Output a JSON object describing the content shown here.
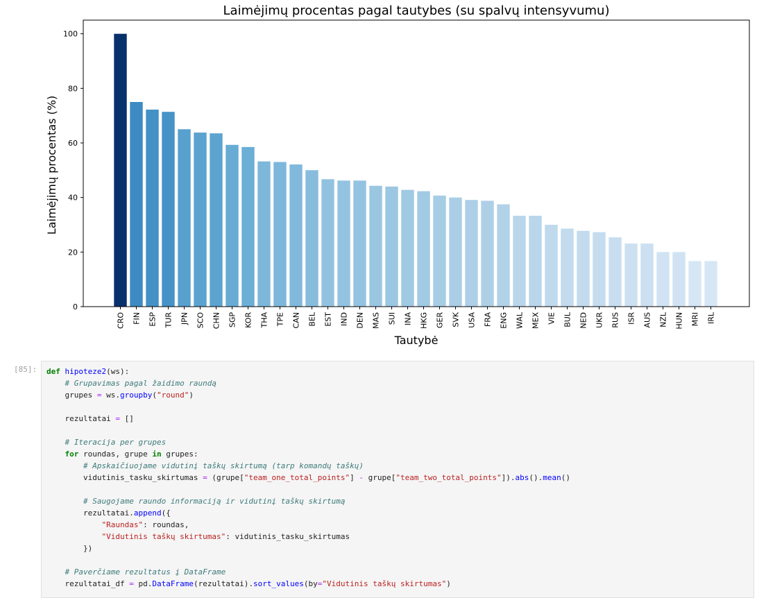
{
  "chart_data": {
    "type": "bar",
    "title": "Laimėjimų procentas pagal tautybes (su spalvų intensyvumu)",
    "xlabel": "Tautybė",
    "ylabel": "Laimėjimų procentas (%)",
    "ylim": [
      0,
      105
    ],
    "yticks": [
      "0",
      "20",
      "40",
      "60",
      "80",
      "100"
    ],
    "grid": false,
    "legend": "none",
    "colormap": "Blues (darker = higher value)",
    "categories": [
      "CRO",
      "FIN",
      "ESP",
      "TUR",
      "JPN",
      "SCO",
      "CHN",
      "SGP",
      "KOR",
      "THA",
      "TPE",
      "CAN",
      "BEL",
      "EST",
      "IND",
      "DEN",
      "MAS",
      "SUI",
      "INA",
      "HKG",
      "GER",
      "SVK",
      "USA",
      "FRA",
      "ENG",
      "WAL",
      "MEX",
      "VIE",
      "BUL",
      "NED",
      "UKR",
      "RUS",
      "ISR",
      "AUS",
      "NZL",
      "HUN",
      "MRI",
      "IRL"
    ],
    "values": [
      100,
      75,
      72.2,
      71.4,
      65,
      63.8,
      63.5,
      59.3,
      58.5,
      53.2,
      53,
      52.1,
      50,
      46.7,
      46.2,
      46.2,
      44.3,
      44,
      42.8,
      42.3,
      40.7,
      40,
      39.1,
      38.8,
      37.5,
      33.3,
      33.3,
      30,
      28.6,
      27.8,
      27.3,
      25.4,
      23.1,
      23.1,
      20,
      20,
      16.7,
      16.7
    ]
  },
  "cell": {
    "prompt": "[85]:",
    "code_lines": [
      [
        [
          "kw",
          "def"
        ],
        [
          "tx",
          " "
        ],
        [
          "fn",
          "hipoteze2"
        ],
        [
          "tx",
          "(ws):"
        ]
      ],
      [
        [
          "tx",
          "    "
        ],
        [
          "cm",
          "# Grupavimas pagal žaidimo raundą"
        ]
      ],
      [
        [
          "tx",
          "    grupes "
        ],
        [
          "op",
          "="
        ],
        [
          "tx",
          " ws."
        ],
        [
          "fn",
          "groupby"
        ],
        [
          "tx",
          "("
        ],
        [
          "st",
          "\"round\""
        ],
        [
          "tx",
          ")"
        ]
      ],
      [],
      [
        [
          "tx",
          "    rezultatai "
        ],
        [
          "op",
          "="
        ],
        [
          "tx",
          " []"
        ]
      ],
      [],
      [
        [
          "tx",
          "    "
        ],
        [
          "cm",
          "# Iteracija per grupes"
        ]
      ],
      [
        [
          "tx",
          "    "
        ],
        [
          "kw",
          "for"
        ],
        [
          "tx",
          " roundas, grupe "
        ],
        [
          "kw",
          "in"
        ],
        [
          "tx",
          " grupes:"
        ]
      ],
      [
        [
          "tx",
          "        "
        ],
        [
          "cm",
          "# Apskaičiuojame vidutinį taškų skirtumą (tarp komandų taškų)"
        ]
      ],
      [
        [
          "tx",
          "        vidutinis_tasku_skirtumas "
        ],
        [
          "op",
          "="
        ],
        [
          "tx",
          " (grupe["
        ],
        [
          "st",
          "\"team_one_total_points\""
        ],
        [
          "tx",
          "] "
        ],
        [
          "op",
          "-"
        ],
        [
          "tx",
          " grupe["
        ],
        [
          "st",
          "\"team_two_total_points\""
        ],
        [
          "tx",
          "])."
        ],
        [
          "fn",
          "abs"
        ],
        [
          "tx",
          "()."
        ],
        [
          "fn",
          "mean"
        ],
        [
          "tx",
          "()"
        ]
      ],
      [],
      [
        [
          "tx",
          "        "
        ],
        [
          "cm",
          "# Saugojame raundo informaciją ir vidutinį taškų skirtumą"
        ]
      ],
      [
        [
          "tx",
          "        rezultatai."
        ],
        [
          "fn",
          "append"
        ],
        [
          "tx",
          "({"
        ]
      ],
      [
        [
          "tx",
          "            "
        ],
        [
          "st",
          "\"Raundas\""
        ],
        [
          "tx",
          ": roundas,"
        ]
      ],
      [
        [
          "tx",
          "            "
        ],
        [
          "st",
          "\"Vidutinis taškų skirtumas\""
        ],
        [
          "tx",
          ": vidutinis_tasku_skirtumas"
        ]
      ],
      [
        [
          "tx",
          "        })"
        ]
      ],
      [],
      [
        [
          "tx",
          "    "
        ],
        [
          "cm",
          "# Paverčiame rezultatus į DataFrame"
        ]
      ],
      [
        [
          "tx",
          "    rezultatai_df "
        ],
        [
          "op",
          "="
        ],
        [
          "tx",
          " pd."
        ],
        [
          "fn",
          "DataFrame"
        ],
        [
          "tx",
          "(rezultatai)."
        ],
        [
          "fn",
          "sort_values"
        ],
        [
          "tx",
          "(by"
        ],
        [
          "op",
          "="
        ],
        [
          "st",
          "\"Vidutinis taškų skirtumas\""
        ],
        [
          "tx",
          ")"
        ]
      ]
    ]
  }
}
